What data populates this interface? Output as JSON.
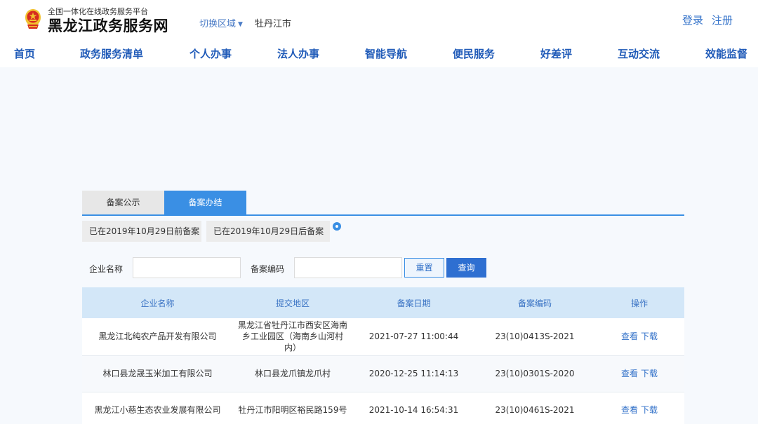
{
  "header": {
    "platform_subtitle": "全国一体化在线政务服务平台",
    "site_title": "黑龙江政务服务网",
    "region_switch_label": "切换区域",
    "current_region": "牡丹江市",
    "login_label": "登录",
    "register_label": "注册"
  },
  "nav": {
    "items": [
      "首页",
      "政务服务清单",
      "个人办事",
      "法人办事",
      "智能导航",
      "便民服务",
      "好差评",
      "互动交流",
      "效能监督"
    ]
  },
  "tabs": {
    "items": [
      "备案公示",
      "备案办结"
    ],
    "active_index": 1
  },
  "subtabs": {
    "items": [
      "已在2019年10月29日前备案",
      "已在2019年10月29日后备案"
    ]
  },
  "filters": {
    "company_label": "企业名称",
    "company_value": "",
    "code_label": "备案编码",
    "code_value": "",
    "reset_label": "重置",
    "query_label": "查询"
  },
  "table": {
    "columns": [
      "企业名称",
      "提交地区",
      "备案日期",
      "备案编码",
      "操作"
    ],
    "rows": [
      {
        "company": "黑龙江北纯农产品开发有限公司",
        "region": "黑龙江省牡丹江市西安区海南乡工业园区（海南乡山河村内）",
        "date": "2021-07-27 11:00:44",
        "code": "23(10)0413S-2021"
      },
      {
        "company": "林口县龙晟玉米加工有限公司",
        "region": "林口县龙爪镇龙爪村",
        "date": "2020-12-25 11:14:13",
        "code": "23(10)0301S-2020"
      },
      {
        "company": "黑龙江小慈生态农业发展有限公司",
        "region": "牡丹江市阳明区裕民路159号",
        "date": "2021-10-14 16:54:31",
        "code": "23(10)0461S-2021"
      }
    ],
    "view_label": "查看",
    "download_label": "下载"
  },
  "colors": {
    "accent": "#3a8fe4",
    "nav_text": "#1f5ab8",
    "table_header_bg": "#d3e7f8",
    "emblem_red": "#d62b1f",
    "emblem_gold": "#f2c230"
  }
}
